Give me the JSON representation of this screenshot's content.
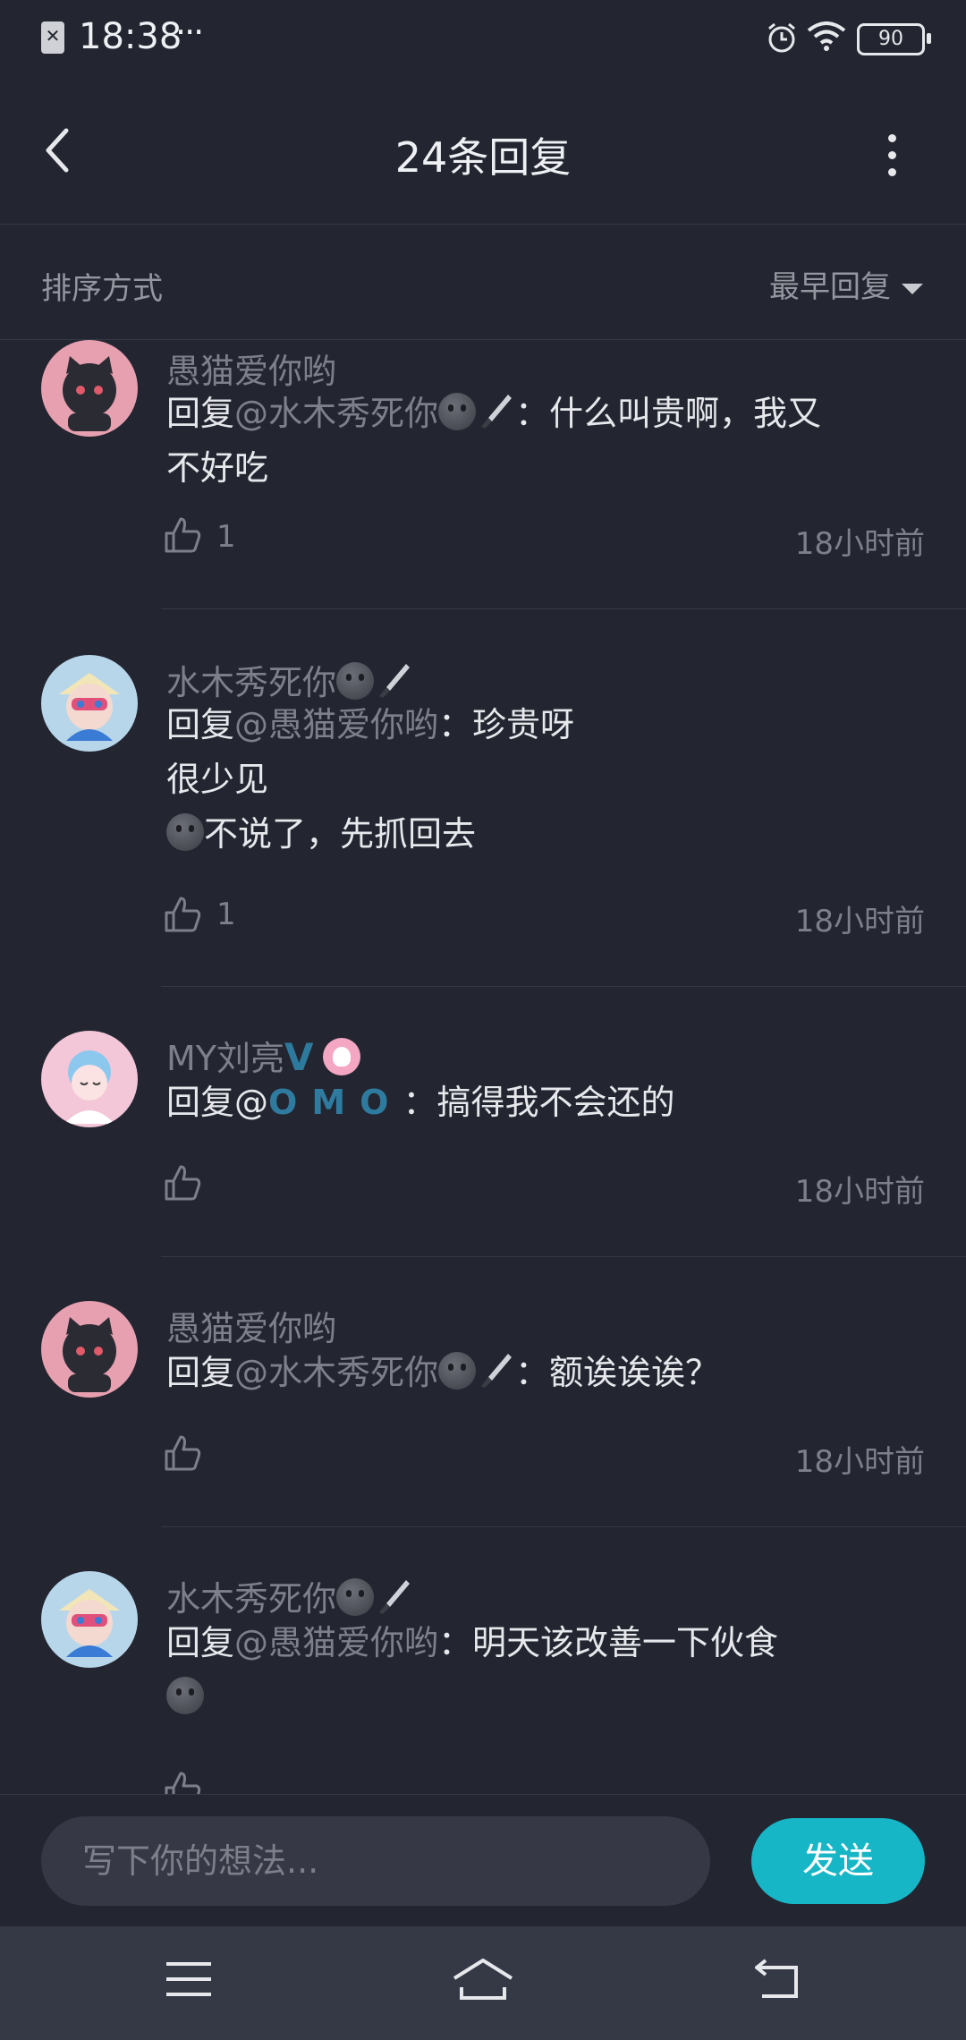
{
  "status_bar": {
    "time": "18:38",
    "dots": "···",
    "battery": "90"
  },
  "header": {
    "title": "24条回复"
  },
  "sort_bar": {
    "label": "排序方式",
    "value": "最早回复"
  },
  "replies": [
    {
      "user": "愚猫爱你哟",
      "reply_prefix": "回复",
      "mention": "@水木秀死你",
      "text_lines": [
        "：什么叫贵啊，我又",
        "不好吃"
      ],
      "likes": "1",
      "time": "18小时前"
    },
    {
      "user": "水木秀死你",
      "reply_prefix": "回复",
      "mention": "@愚猫爱你哟",
      "text_lines": [
        "：珍贵呀",
        "很少见",
        "不说了，先抓回去"
      ],
      "likes": "1",
      "time": "18小时前"
    },
    {
      "user": "MY刘亮",
      "user_badge": "V",
      "reply_prefix": "回复@",
      "mention": "OMO",
      "text_lines": [
        "：搞得我不会还的"
      ],
      "likes": "",
      "time": "18小时前"
    },
    {
      "user": "愚猫爱你哟",
      "reply_prefix": "回复",
      "mention": "@水木秀死你",
      "text_lines": [
        "：额诶诶诶？"
      ],
      "likes": "",
      "time": "18小时前"
    },
    {
      "user": "水木秀死你",
      "reply_prefix": "回复",
      "mention": "@愚猫爱你哟",
      "text_lines": [
        "：明天该改善一下伙食"
      ],
      "likes": "",
      "time": ""
    }
  ],
  "input": {
    "placeholder": "写下你的想法...",
    "value": ""
  },
  "send_button": "发送",
  "icons": {
    "back": "chevron-left-icon",
    "more": "more-vertical-icon",
    "sort_caret": "caret-down-icon",
    "like": "thumbs-up-icon",
    "alarm": "alarm-clock-icon",
    "wifi": "wifi-icon",
    "nav_menu": "menu-icon",
    "nav_home": "home-icon",
    "nav_back": "return-icon"
  },
  "colors": {
    "background": "#232530",
    "accent": "#17b6c6",
    "muted_text": "#7d808a",
    "mention_blue": "#2f7ba0"
  }
}
